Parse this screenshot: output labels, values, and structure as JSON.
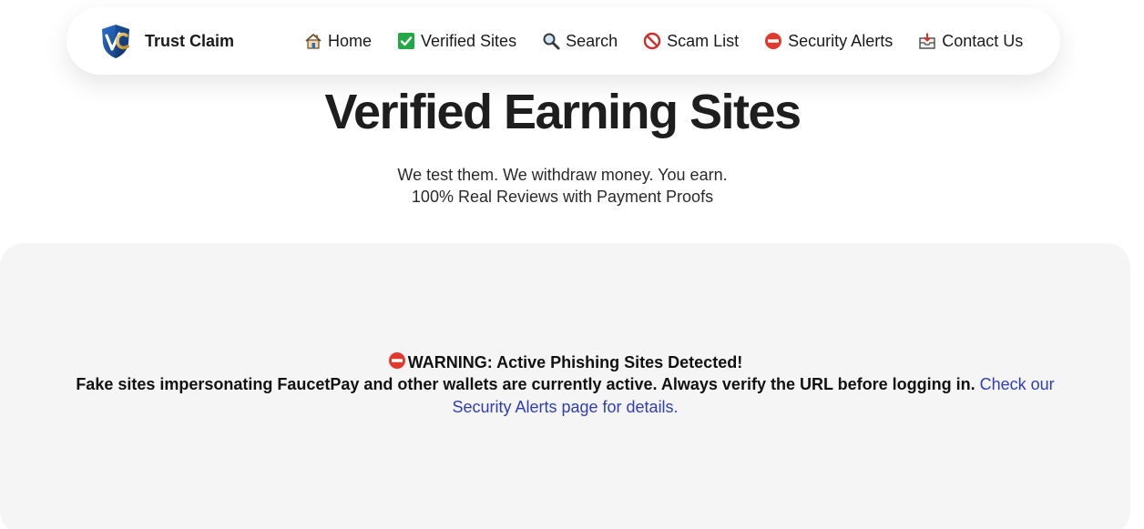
{
  "brand": {
    "name": "Trust Claim",
    "logo_icon": "shield-vc-logo"
  },
  "nav": [
    {
      "label": "Home",
      "icon": "house-icon"
    },
    {
      "label": "Verified Sites",
      "icon": "check-mark-icon"
    },
    {
      "label": "Search",
      "icon": "magnifier-icon"
    },
    {
      "label": "Scam List",
      "icon": "prohibited-icon"
    },
    {
      "label": "Security Alerts",
      "icon": "no-entry-icon"
    },
    {
      "label": "Contact Us",
      "icon": "inbox-icon"
    }
  ],
  "hero": {
    "title": "Verified Earning Sites",
    "subtitle_line1": "We test them. We withdraw money. You earn.",
    "subtitle_line2": "100% Real Reviews with Payment Proofs"
  },
  "warning": {
    "title": "WARNING: Active Phishing Sites Detected!",
    "body": "Fake sites impersonating FaucetPay and other wallets are currently active. Always verify the URL before logging in.",
    "link": "Check our Security Alerts page for details."
  },
  "colors": {
    "link": "#2f3fb3",
    "panel_bg": "#f5f5f5",
    "alert_red": "#e03a2f",
    "check_green": "#22a845"
  }
}
